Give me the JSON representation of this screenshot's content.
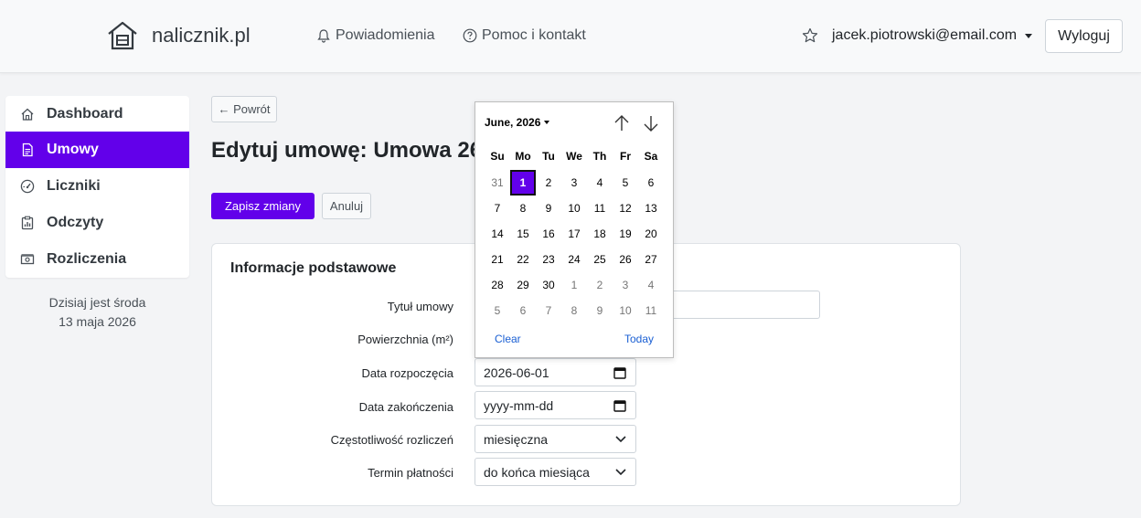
{
  "app": {
    "name": "nalicznik.pl",
    "accent_color": "#6200ea"
  },
  "header": {
    "nav": [
      {
        "label": "Powiadomienia",
        "icon": "bell-icon"
      },
      {
        "label": "Pomoc i kontakt",
        "icon": "question-circle-icon"
      }
    ],
    "user_email": "jacek.piotrowski@email.com",
    "logout_label": "Wyloguj"
  },
  "sidebar": {
    "items": [
      {
        "label": "Dashboard",
        "icon": "house-icon",
        "active": false
      },
      {
        "label": "Umowy",
        "icon": "document-icon",
        "active": true
      },
      {
        "label": "Liczniki",
        "icon": "speedometer-icon",
        "active": false
      },
      {
        "label": "Odczyty",
        "icon": "clipboard-chart-icon",
        "active": false
      },
      {
        "label": "Rozliczenia",
        "icon": "cash-icon",
        "active": false
      }
    ],
    "today_line1": "Dzisiaj jest środa",
    "today_line2": "13 maja 2026"
  },
  "main": {
    "back_label": "← Powrót",
    "title": "Edytuj umowę: Umowa 260",
    "save_label": "Zapisz zmiany",
    "cancel_label": "Anuluj",
    "card_title": "Informacje podstawowe",
    "fields": [
      {
        "label": "Tytuł umowy",
        "value": ""
      },
      {
        "label": "Powierzchnia (m²)",
        "value": ""
      },
      {
        "label": "Data rozpoczęcia",
        "value": "2026-06-01"
      },
      {
        "label": "Data zakończenia",
        "value": "yyyy-mm-dd"
      },
      {
        "label": "Częstotliwość rozliczeń",
        "value": "miesięczna"
      },
      {
        "label": "Termin płatności",
        "value": "do końca miesiąca"
      }
    ]
  },
  "datepicker": {
    "month_label": "June, 2026",
    "weekdays": [
      "Su",
      "Mo",
      "Tu",
      "We",
      "Th",
      "Fr",
      "Sa"
    ],
    "weeks": [
      [
        "31",
        "1",
        "2",
        "3",
        "4",
        "5",
        "6"
      ],
      [
        "7",
        "8",
        "9",
        "10",
        "11",
        "12",
        "13"
      ],
      [
        "14",
        "15",
        "16",
        "17",
        "18",
        "19",
        "20"
      ],
      [
        "21",
        "22",
        "23",
        "24",
        "25",
        "26",
        "27"
      ],
      [
        "28",
        "29",
        "30",
        "1",
        "2",
        "3",
        "4"
      ],
      [
        "5",
        "6",
        "7",
        "8",
        "9",
        "10",
        "11"
      ]
    ],
    "selected_day": "1",
    "clear_label": "Clear",
    "today_label": "Today"
  }
}
